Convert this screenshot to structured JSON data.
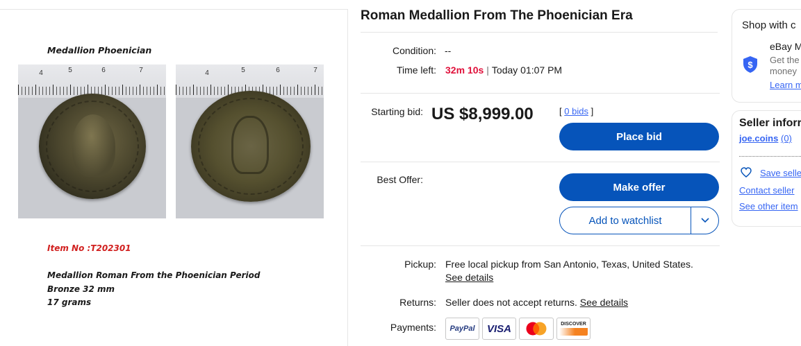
{
  "gallery": {
    "doc_title": "Medallion Phoenician",
    "ruler_numbers_left": [
      "4",
      "5",
      "6",
      "7"
    ],
    "ruler_numbers_right": [
      "4",
      "5",
      "6",
      "7"
    ],
    "item_no": "Item No :T202301",
    "description_lines": [
      "Medallion Roman From the Phoenician Period",
      "Bronze 32 mm",
      "17 grams"
    ]
  },
  "listing": {
    "title": "Roman Medallion From The Phoenician Era",
    "condition_label": "Condition:",
    "condition_value": "--",
    "time_left_label": "Time left:",
    "time_left_value": "32m 10s",
    "time_left_separator": "|",
    "time_left_end": "Today 01:07 PM",
    "starting_bid_label": "Starting bid:",
    "starting_bid_value": "US $8,999.00",
    "bids_prefix": "[",
    "bids_link": "0 bids",
    "bids_suffix": "]",
    "place_bid_button": "Place bid",
    "best_offer_label": "Best Offer:",
    "make_offer_button": "Make offer",
    "watchlist_button": "Add to watchlist",
    "pickup_label": "Pickup:",
    "pickup_value": "Free local pickup from San Antonio, Texas, United States.",
    "pickup_link": "See details",
    "returns_label": "Returns:",
    "returns_value": "Seller does not accept returns.",
    "returns_link": "See details",
    "payments_label": "Payments:",
    "payment_methods": [
      "PayPal",
      "VISA",
      "mastercard-icon",
      "DISCOVER"
    ]
  },
  "sidebar": {
    "shop_heading": "Shop with c",
    "ebay_title": "eBay M",
    "ebay_line1": "Get the",
    "ebay_line2": "money",
    "learn_link": "Learn m",
    "seller_heading": "Seller inforr",
    "seller_name": "joe.coins",
    "seller_feedback": "(0)",
    "save_seller": "Save selle",
    "contact_seller": "Contact seller",
    "see_other": "See other item"
  },
  "colors": {
    "primary_blue": "#0654ba",
    "link_blue": "#3665f3",
    "time_red": "#e0103a",
    "item_no_red": "#d1201f"
  }
}
